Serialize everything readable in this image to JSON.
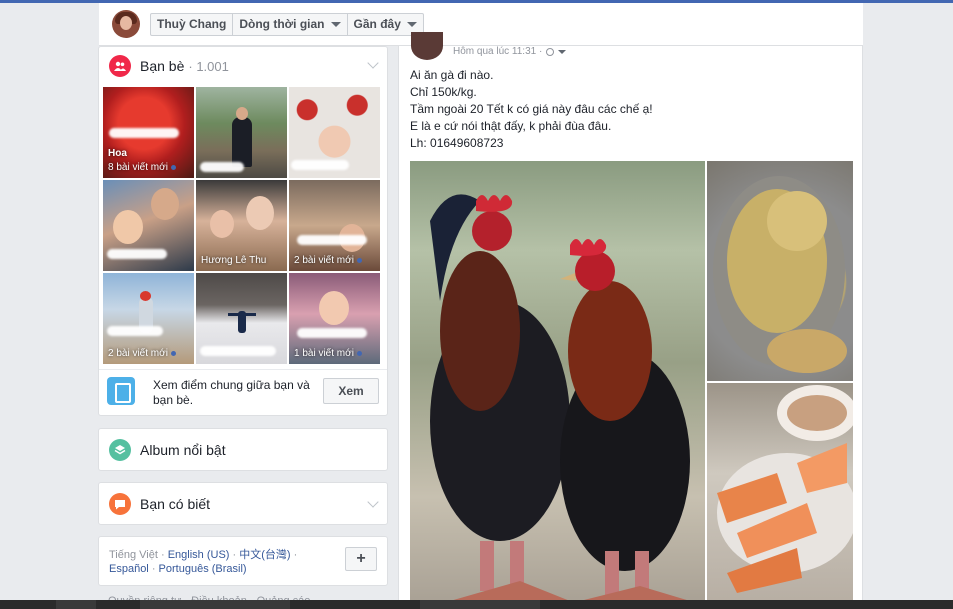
{
  "header": {
    "user_name": "Thuỳ Chang",
    "timeline_label": "Dòng thời gian",
    "recent_label": "Gần đây"
  },
  "friends": {
    "title": "Bạn bè",
    "count": "· 1.001",
    "tiles": [
      {
        "name": "Hoa",
        "caption": "8 bài viết mới"
      },
      {
        "name": "",
        "caption": ""
      },
      {
        "name": "",
        "caption": ""
      },
      {
        "name": "",
        "caption": ""
      },
      {
        "name": "",
        "caption": "Hương Lê Thu"
      },
      {
        "name": "",
        "caption": "2 bài viết mới"
      },
      {
        "name": "",
        "caption": "2 bài viết mới"
      },
      {
        "name": "",
        "caption": ""
      },
      {
        "name": "",
        "caption": "1 bài viết mới"
      }
    ],
    "suggest_text": "Xem điểm chung giữa bạn và bạn bè.",
    "suggest_button": "Xem"
  },
  "album": {
    "title": "Album nổi bật"
  },
  "know": {
    "title": "Bạn có biết"
  },
  "languages": {
    "current": "Tiếng Việt",
    "links": [
      "English (US)",
      "中文(台灣)",
      "Español",
      "Português (Brasil)"
    ]
  },
  "footer": {
    "links": "Quyền riêng tư · Điều khoản · Quảng cáo"
  },
  "post": {
    "time": "Hôm qua lúc 11:31 ·",
    "lines": [
      "Ai ăn gà đi nào.",
      "Chỉ 150k/kg.",
      "Tầm ngoài 20 Tết k có giá này đâu các chế ạ!",
      "E là e cứ nói thật đấy, k phải đùa đâu.",
      "Lh: 01649608723"
    ]
  },
  "colors": {
    "friends_icon": "#f02849",
    "album_icon": "#55c0a0",
    "know_icon": "#f7733b",
    "brand": "#4267b2"
  }
}
